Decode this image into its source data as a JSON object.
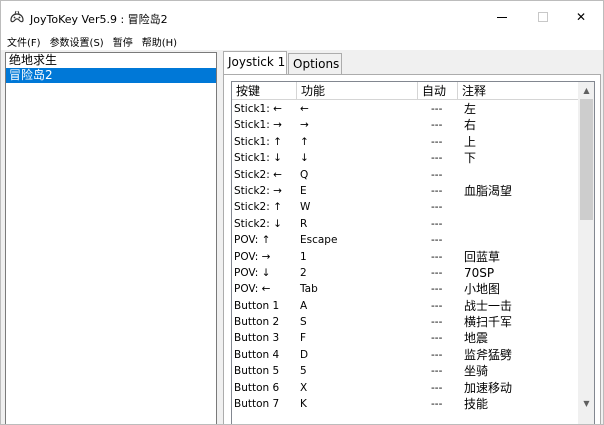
{
  "window": {
    "title": "JoyToKey Ver5.9 : 冒险岛2",
    "minimize_icon": "minimize-icon",
    "maximize_icon": "maximize-icon",
    "close_glyph": "✕"
  },
  "menu": [
    "文件(F)",
    "参数设置(S)",
    "暂停",
    "帮助(H)"
  ],
  "profiles": [
    {
      "name": "绝地求生",
      "selected": false
    },
    {
      "name": "冒险岛2",
      "selected": true
    }
  ],
  "tabs": [
    {
      "label": "Joystick 1",
      "active": true
    },
    {
      "label": "Options",
      "active": false
    }
  ],
  "table": {
    "headers": [
      "按键",
      "功能",
      "自动",
      "注释"
    ],
    "rows": [
      {
        "key": "Stick1: ←",
        "func": "←",
        "auto": "---",
        "note": "左"
      },
      {
        "key": "Stick1: →",
        "func": "→",
        "auto": "---",
        "note": "右"
      },
      {
        "key": "Stick1: ↑",
        "func": "↑",
        "auto": "---",
        "note": "上"
      },
      {
        "key": "Stick1: ↓",
        "func": "↓",
        "auto": "---",
        "note": "下"
      },
      {
        "key": "Stick2: ←",
        "func": "Q",
        "auto": "---",
        "note": ""
      },
      {
        "key": "Stick2: →",
        "func": "E",
        "auto": "---",
        "note": "血脂渴望"
      },
      {
        "key": "Stick2: ↑",
        "func": "W",
        "auto": "---",
        "note": ""
      },
      {
        "key": "Stick2: ↓",
        "func": "R",
        "auto": "---",
        "note": ""
      },
      {
        "key": "POV: ↑",
        "func": "Escape",
        "auto": "---",
        "note": ""
      },
      {
        "key": "POV: →",
        "func": "1",
        "auto": "---",
        "note": "回蓝草"
      },
      {
        "key": "POV: ↓",
        "func": "2",
        "auto": "---",
        "note": "70SP"
      },
      {
        "key": "POV: ←",
        "func": "Tab",
        "auto": "---",
        "note": "小地图"
      },
      {
        "key": "Button 1",
        "func": "A",
        "auto": "---",
        "note": "战士一击"
      },
      {
        "key": "Button 2",
        "func": "S",
        "auto": "---",
        "note": "横扫千军"
      },
      {
        "key": "Button 3",
        "func": "F",
        "auto": "---",
        "note": "地震"
      },
      {
        "key": "Button 4",
        "func": "D",
        "auto": "---",
        "note": "监斧猛劈"
      },
      {
        "key": "Button 5",
        "func": "5",
        "auto": "---",
        "note": "坐骑"
      },
      {
        "key": "Button 6",
        "func": "X",
        "auto": "---",
        "note": "加速移动"
      },
      {
        "key": "Button 7",
        "func": "K",
        "auto": "---",
        "note": "技能"
      }
    ]
  },
  "scrollbar": {
    "up_glyph": "▲",
    "down_glyph": "▼"
  }
}
